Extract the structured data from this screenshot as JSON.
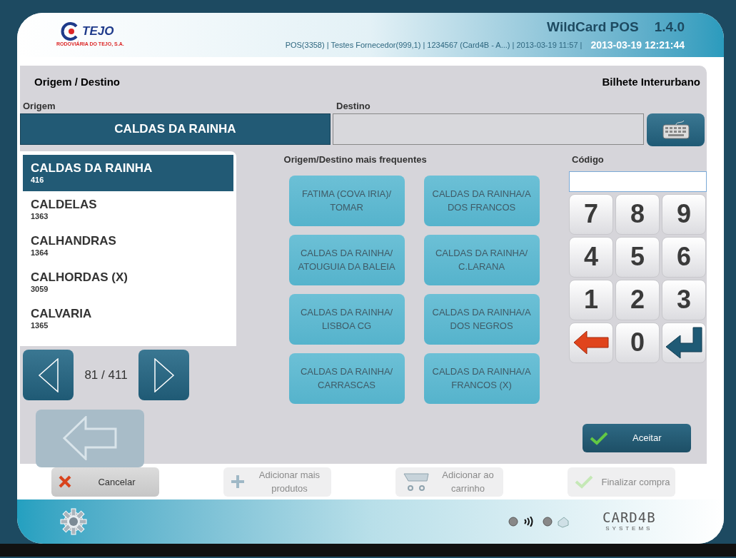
{
  "header": {
    "logo_text": "TEJO",
    "logo_subtitle": "RODOVIÁRIA DO TEJO, S.A.",
    "app_title": "WildCard POS",
    "version": "1.4.0",
    "session_info": "POS(3358) | Testes Fornecedor(999,1) | 1234567 (Card4B - A...) | 2013-03-19 11:57 |",
    "clock": "2013-03-19 12:21:44"
  },
  "panel": {
    "title": "Origem / Destino",
    "ticket_type": "Bilhete Interurbano"
  },
  "origem": {
    "label": "Origem",
    "value": "CALDAS DA RAINHA"
  },
  "destino": {
    "label": "Destino"
  },
  "locations": [
    {
      "name": "CALDAS DA RAINHA",
      "code": "416",
      "selected": true
    },
    {
      "name": "CALDELAS",
      "code": "1363",
      "selected": false
    },
    {
      "name": "CALHANDRAS",
      "code": "1364",
      "selected": false
    },
    {
      "name": "CALHORDAS (X)",
      "code": "3059",
      "selected": false
    },
    {
      "name": "CALVARIA",
      "code": "1365",
      "selected": false
    }
  ],
  "pager": {
    "text": "81 / 411"
  },
  "frequent": {
    "title": "Origem/Destino mais frequentes",
    "routes": [
      "FATIMA (COVA IRIA)/ TOMAR",
      "CALDAS DA RAINHA/A DOS FRANCOS",
      "CALDAS DA RAINHA/ ATOUGUIA DA BALEIA",
      "CALDAS DA RAINHA/ C.LARANA",
      "CALDAS DA RAINHA/ LISBOA CG",
      "CALDAS DA RAINHA/A DOS NEGROS",
      "CALDAS DA RAINHA/ CARRASCAS",
      "CALDAS DA RAINHA/A FRANCOS (X)"
    ]
  },
  "codigo": {
    "label": "Código",
    "keys": [
      {
        "kind": "digit",
        "label": "7"
      },
      {
        "kind": "digit",
        "label": "8"
      },
      {
        "kind": "digit",
        "label": "9"
      },
      {
        "kind": "digit",
        "label": "4"
      },
      {
        "kind": "digit",
        "label": "5"
      },
      {
        "kind": "digit",
        "label": "6"
      },
      {
        "kind": "digit",
        "label": "1"
      },
      {
        "kind": "digit",
        "label": "2"
      },
      {
        "kind": "digit",
        "label": "3"
      },
      {
        "kind": "backspace"
      },
      {
        "kind": "digit",
        "label": "0"
      },
      {
        "kind": "enter"
      }
    ]
  },
  "accept_button": {
    "label": "Aceitar"
  },
  "footer_buttons": [
    {
      "kind": "cancel",
      "label": "Cancelar",
      "disabled": false
    },
    {
      "kind": "add",
      "label": "Adicionar mais produtos",
      "disabled": true
    },
    {
      "kind": "cart",
      "label": "Adicionar ao carrinho",
      "disabled": true
    },
    {
      "kind": "finish",
      "label": "Finalizar compra",
      "disabled": true
    }
  ],
  "brand": {
    "name": "CARD4B",
    "tagline": "SYSTEMS"
  }
}
